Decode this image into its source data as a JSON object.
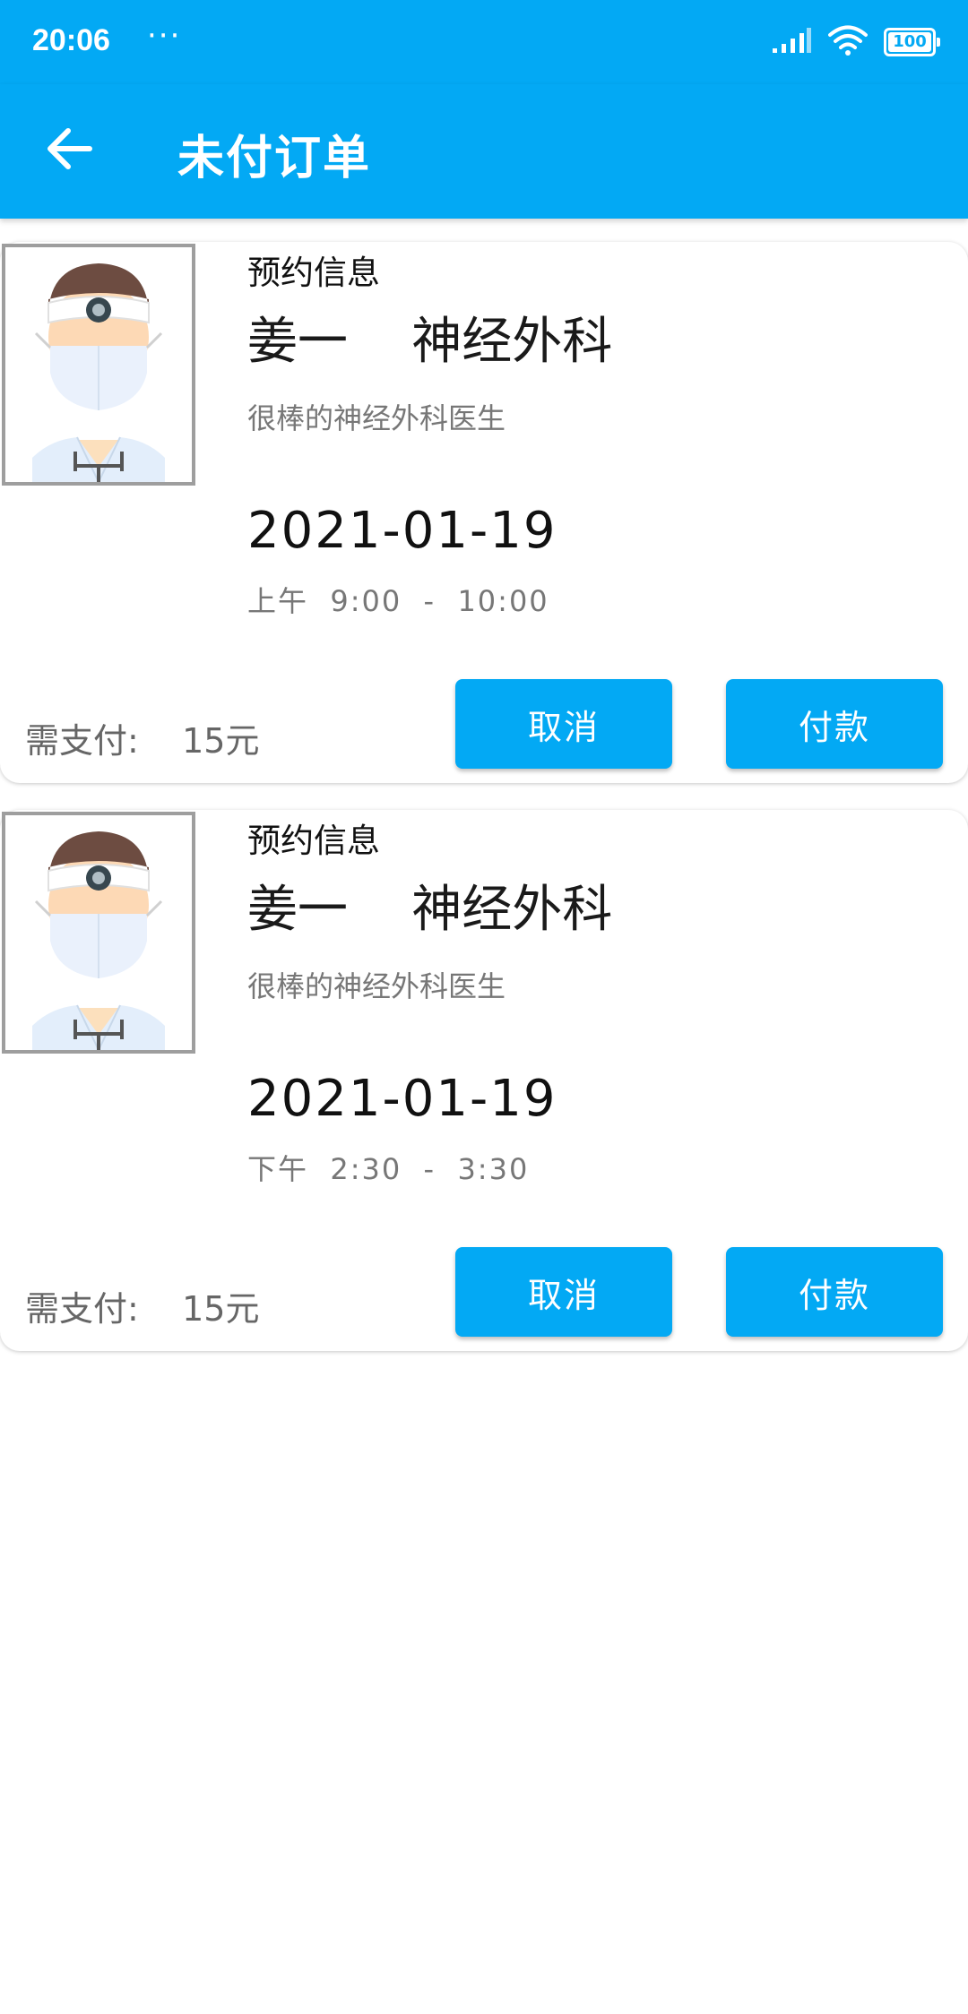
{
  "status_bar": {
    "time": "20:06",
    "dots": "···",
    "battery": "100",
    "signal_icon": "signal-icon",
    "wifi_icon": "wifi-icon",
    "battery_icon": "battery-icon"
  },
  "app_bar": {
    "back_icon": "arrow-left-icon",
    "title": "未付订单"
  },
  "colors": {
    "primary": "#03a9f4",
    "text_primary": "#111111",
    "text_secondary": "#777777"
  },
  "orders": [
    {
      "avatar_icon": "doctor-avatar",
      "section_label": "预约信息",
      "doctor_line": "姜一    神经外科",
      "doctor_desc": "很棒的神经外科医生",
      "date": "2021-01-19",
      "time": "上午  9:00  -  10:00",
      "pay_label": "需支付:    15元",
      "cancel_label": "取消",
      "pay_button_label": "付款"
    },
    {
      "avatar_icon": "doctor-avatar",
      "section_label": "预约信息",
      "doctor_line": "姜一    神经外科",
      "doctor_desc": "很棒的神经外科医生",
      "date": "2021-01-19",
      "time": "下午  2:30  -  3:30",
      "pay_label": "需支付:    15元",
      "cancel_label": "取消",
      "pay_button_label": "付款"
    }
  ]
}
